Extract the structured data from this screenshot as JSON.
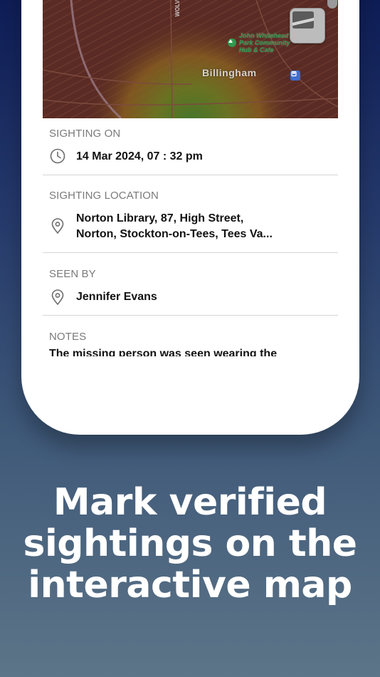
{
  "map": {
    "place_label": "Billingham",
    "poi_label": "John Whitehead Park Community Hub & Cafe",
    "road_label": "WOLV",
    "colors": {
      "base": "#5a2b24",
      "ring_outer": "#6e3b23",
      "ring_mid": "#8a5a1f",
      "ring_inner": "#4f6a2a"
    }
  },
  "details": {
    "sighting_on": {
      "label": "SIGHTING ON",
      "icon": "clock-icon",
      "value": "14 Mar 2024, 07 : 32 pm"
    },
    "sighting_location": {
      "label": "SIGHTING LOCATION",
      "icon": "location-pin-icon",
      "line1": "Norton Library, 87, High Street,",
      "line2": "Norton, Stockton-on-Tees, Tees Va..."
    },
    "seen_by": {
      "label": "SEEN BY",
      "icon": "location-pin-icon",
      "value": "Jennifer Evans"
    },
    "notes": {
      "label": "NOTES",
      "value": "The missing person was seen wearing the"
    }
  },
  "caption": {
    "line1": "Mark verified",
    "line2": "sightings on the",
    "line3": "interactive map"
  }
}
